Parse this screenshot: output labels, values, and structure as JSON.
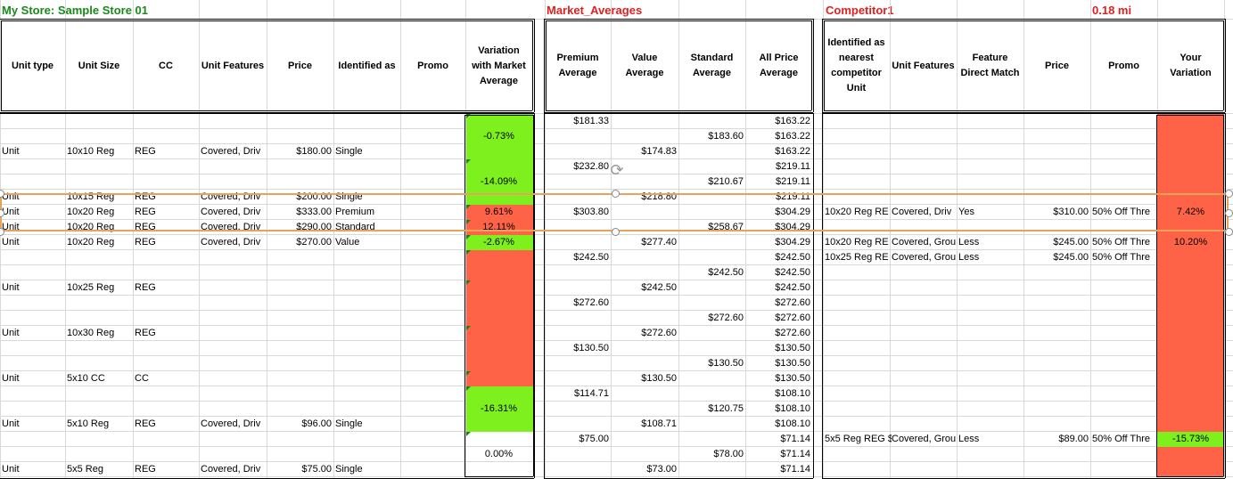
{
  "sections": {
    "my_store": {
      "title": "My Store: Sample Store 01",
      "color": "#1a8a1a"
    },
    "market": {
      "title": "Market_Averages",
      "color": "#e02020"
    },
    "competitor": {
      "title": "Competitor1",
      "distance": "0.18 mi",
      "color": "#e02020"
    }
  },
  "headers": {
    "my_store": [
      "Unit type",
      "Unit Size",
      "CC",
      "Unit Features",
      "Price",
      "Identified as",
      "Promo",
      "Variation with Market Average"
    ],
    "market": [
      "Premium Average",
      "Value Average",
      "Standard Average",
      "All Price Average"
    ],
    "competitor": [
      "Identified as nearest competitor Unit",
      "Unit Features",
      "Feature Direct Match",
      "Price",
      "Promo",
      "Your Variation"
    ]
  },
  "colors": {
    "green": "#7ef01e",
    "red": "#ff6347",
    "selection": "#e8a35a"
  },
  "rows": [
    {
      "ut": "",
      "us": "",
      "cc": "",
      "feat": "",
      "price": "",
      "id": "",
      "var": "",
      "prem": "$181.33",
      "val": "",
      "std": "",
      "all": "$163.22",
      "comp": "",
      "cfeat": "",
      "match": "",
      "cprice": "",
      "promo": "",
      "yvar": ""
    },
    {
      "ut": "",
      "us": "",
      "cc": "",
      "feat": "",
      "price": "",
      "id": "",
      "var": "-0.73%",
      "prem": "",
      "val": "",
      "std": "$183.60",
      "all": "$163.22",
      "comp": "",
      "cfeat": "",
      "match": "",
      "cprice": "",
      "promo": "",
      "yvar": ""
    },
    {
      "ut": "Unit",
      "us": "10x10 Reg",
      "cc": "REG",
      "feat": "Covered, Driv",
      "price": "$180.00",
      "id": "Single",
      "var": "",
      "prem": "",
      "val": "$174.83",
      "std": "",
      "all": "$163.22",
      "comp": "",
      "cfeat": "",
      "match": "",
      "cprice": "",
      "promo": "",
      "yvar": ""
    },
    {
      "ut": "",
      "us": "",
      "cc": "",
      "feat": "",
      "price": "",
      "id": "",
      "var": "",
      "prem": "$232.80",
      "val": "",
      "std": "",
      "all": "$219.11",
      "comp": "",
      "cfeat": "",
      "match": "",
      "cprice": "",
      "promo": "",
      "yvar": ""
    },
    {
      "ut": "",
      "us": "",
      "cc": "",
      "feat": "",
      "price": "",
      "id": "",
      "var": "-14.09%",
      "prem": "",
      "val": "",
      "std": "$210.67",
      "all": "$219.11",
      "comp": "",
      "cfeat": "",
      "match": "",
      "cprice": "",
      "promo": "",
      "yvar": ""
    },
    {
      "ut": "Unit",
      "us": "10x15 Reg",
      "cc": "REG",
      "feat": "Covered, Driv",
      "price": "$200.00",
      "id": "Single",
      "var": "",
      "prem": "",
      "val": "$218.80",
      "std": "",
      "all": "$219.11",
      "comp": "",
      "cfeat": "",
      "match": "",
      "cprice": "",
      "promo": "",
      "yvar": ""
    },
    {
      "ut": "Unit",
      "us": "10x20 Reg",
      "cc": "REG",
      "feat": "Covered, Driv",
      "price": "$333.00",
      "id": "Premium",
      "var": "9.61%",
      "prem": "$303.80",
      "val": "",
      "std": "",
      "all": "$304.29",
      "comp": "10x20 Reg RE",
      "cfeat": "Covered, Driv",
      "match": "Yes",
      "cprice": "$310.00",
      "promo": "50% Off Thre",
      "yvar": "7.42%"
    },
    {
      "ut": "Unit",
      "us": "10x20 Reg",
      "cc": "REG",
      "feat": "Covered, Driv",
      "price": "$290.00",
      "id": "Standard",
      "var": "12.11%",
      "prem": "",
      "val": "",
      "std": "$258.67",
      "all": "$304.29",
      "comp": "",
      "cfeat": "",
      "match": "",
      "cprice": "",
      "promo": "",
      "yvar": ""
    },
    {
      "ut": "Unit",
      "us": "10x20 Reg",
      "cc": "REG",
      "feat": "Covered, Driv",
      "price": "$270.00",
      "id": "Value",
      "var": "-2.67%",
      "prem": "",
      "val": "$277.40",
      "std": "",
      "all": "$304.29",
      "comp": "10x20 Reg RE",
      "cfeat": "Covered, Grou",
      "match": "Less",
      "cprice": "$245.00",
      "promo": "50% Off Thre",
      "yvar": "10.20%"
    },
    {
      "ut": "",
      "us": "",
      "cc": "",
      "feat": "",
      "price": "",
      "id": "",
      "var": "",
      "prem": "$242.50",
      "val": "",
      "std": "",
      "all": "$242.50",
      "comp": "10x25 Reg RE",
      "cfeat": "Covered, Grou",
      "match": "Less",
      "cprice": "$245.00",
      "promo": "50% Off Thre",
      "yvar": ""
    },
    {
      "ut": "",
      "us": "",
      "cc": "",
      "feat": "",
      "price": "",
      "id": "",
      "var": "",
      "prem": "",
      "val": "",
      "std": "$242.50",
      "all": "$242.50",
      "comp": "",
      "cfeat": "",
      "match": "",
      "cprice": "",
      "promo": "",
      "yvar": ""
    },
    {
      "ut": "Unit",
      "us": "10x25 Reg",
      "cc": "REG",
      "feat": "",
      "price": "",
      "id": "",
      "var": "",
      "prem": "",
      "val": "$242.50",
      "std": "",
      "all": "$242.50",
      "comp": "",
      "cfeat": "",
      "match": "",
      "cprice": "",
      "promo": "",
      "yvar": ""
    },
    {
      "ut": "",
      "us": "",
      "cc": "",
      "feat": "",
      "price": "",
      "id": "",
      "var": "",
      "prem": "$272.60",
      "val": "",
      "std": "",
      "all": "$272.60",
      "comp": "",
      "cfeat": "",
      "match": "",
      "cprice": "",
      "promo": "",
      "yvar": ""
    },
    {
      "ut": "",
      "us": "",
      "cc": "",
      "feat": "",
      "price": "",
      "id": "",
      "var": "",
      "prem": "",
      "val": "",
      "std": "$272.60",
      "all": "$272.60",
      "comp": "",
      "cfeat": "",
      "match": "",
      "cprice": "",
      "promo": "",
      "yvar": ""
    },
    {
      "ut": "Unit",
      "us": "10x30 Reg",
      "cc": "REG",
      "feat": "",
      "price": "",
      "id": "",
      "var": "",
      "prem": "",
      "val": "$272.60",
      "std": "",
      "all": "$272.60",
      "comp": "",
      "cfeat": "",
      "match": "",
      "cprice": "",
      "promo": "",
      "yvar": ""
    },
    {
      "ut": "",
      "us": "",
      "cc": "",
      "feat": "",
      "price": "",
      "id": "",
      "var": "",
      "prem": "$130.50",
      "val": "",
      "std": "",
      "all": "$130.50",
      "comp": "",
      "cfeat": "",
      "match": "",
      "cprice": "",
      "promo": "",
      "yvar": ""
    },
    {
      "ut": "",
      "us": "",
      "cc": "",
      "feat": "",
      "price": "",
      "id": "",
      "var": "",
      "prem": "",
      "val": "",
      "std": "$130.50",
      "all": "$130.50",
      "comp": "",
      "cfeat": "",
      "match": "",
      "cprice": "",
      "promo": "",
      "yvar": ""
    },
    {
      "ut": "Unit",
      "us": "5x10 CC",
      "cc": "CC",
      "feat": "",
      "price": "",
      "id": "",
      "var": "",
      "prem": "",
      "val": "$130.50",
      "std": "",
      "all": "$130.50",
      "comp": "",
      "cfeat": "",
      "match": "",
      "cprice": "",
      "promo": "",
      "yvar": ""
    },
    {
      "ut": "",
      "us": "",
      "cc": "",
      "feat": "",
      "price": "",
      "id": "",
      "var": "",
      "prem": "$114.71",
      "val": "",
      "std": "",
      "all": "$108.10",
      "comp": "",
      "cfeat": "",
      "match": "",
      "cprice": "",
      "promo": "",
      "yvar": ""
    },
    {
      "ut": "",
      "us": "",
      "cc": "",
      "feat": "",
      "price": "",
      "id": "",
      "var": "-16.31%",
      "prem": "",
      "val": "",
      "std": "$120.75",
      "all": "$108.10",
      "comp": "",
      "cfeat": "",
      "match": "",
      "cprice": "",
      "promo": "",
      "yvar": ""
    },
    {
      "ut": "Unit",
      "us": "5x10 Reg",
      "cc": "REG",
      "feat": "Covered, Driv",
      "price": "$96.00",
      "id": "Single",
      "var": "",
      "prem": "",
      "val": "$108.71",
      "std": "",
      "all": "$108.10",
      "comp": "",
      "cfeat": "",
      "match": "",
      "cprice": "",
      "promo": "",
      "yvar": ""
    },
    {
      "ut": "",
      "us": "",
      "cc": "",
      "feat": "",
      "price": "",
      "id": "",
      "var": "",
      "prem": "$75.00",
      "val": "",
      "std": "",
      "all": "$71.14",
      "comp": "5x5 Reg REG $",
      "cfeat": "Covered, Grou",
      "match": "Less",
      "cprice": "$89.00",
      "promo": "50% Off Thre",
      "yvar": "-15.73%"
    },
    {
      "ut": "",
      "us": "",
      "cc": "",
      "feat": "",
      "price": "",
      "id": "",
      "var": "0.00%",
      "prem": "",
      "val": "",
      "std": "$78.00",
      "all": "$71.14",
      "comp": "",
      "cfeat": "",
      "match": "",
      "cprice": "",
      "promo": "",
      "yvar": ""
    },
    {
      "ut": "Unit",
      "us": "5x5 Reg",
      "cc": "REG",
      "feat": "Covered, Driv",
      "price": "$75.00",
      "id": "Single",
      "var": "",
      "prem": "",
      "val": "$73.00",
      "std": "",
      "all": "$71.14",
      "comp": "",
      "cfeat": "",
      "match": "",
      "cprice": "",
      "promo": "",
      "yvar": ""
    }
  ]
}
